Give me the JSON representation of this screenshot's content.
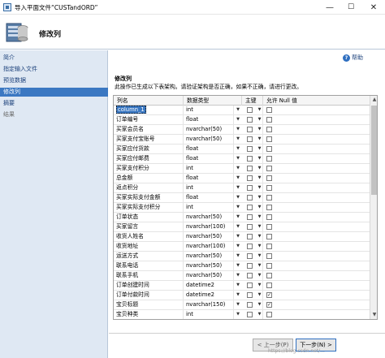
{
  "window": {
    "title": "导入平面文件“CUSTandORD”",
    "minimize": "—",
    "maximize": "☐",
    "close": "✕"
  },
  "header": {
    "title": "修改列"
  },
  "nav": {
    "items": [
      {
        "label": "简介",
        "state": "normal"
      },
      {
        "label": "指定输入文件",
        "state": "normal"
      },
      {
        "label": "预览数据",
        "state": "normal"
      },
      {
        "label": "修改列",
        "state": "active"
      },
      {
        "label": "摘要",
        "state": "normal"
      },
      {
        "label": "结果",
        "state": "disabled"
      }
    ]
  },
  "help": {
    "label": "帮助"
  },
  "section": {
    "title": "修改列",
    "description": "此操作已生成以下表架构。请验证架构是否正确，如果不正确，请进行更改。"
  },
  "grid": {
    "headers": {
      "name": "列名",
      "type": "数据类型",
      "key": "主键",
      "null": "允许 Null 值"
    },
    "rows": [
      {
        "name": "column_1",
        "type": "int",
        "key": false,
        "nullable": false,
        "selected": true
      },
      {
        "name": "订单编号",
        "type": "float",
        "key": false,
        "nullable": false
      },
      {
        "name": "买家会员名",
        "type": "nvarchar(50)",
        "key": false,
        "nullable": false
      },
      {
        "name": "买家支付宝账号",
        "type": "nvarchar(50)",
        "key": false,
        "nullable": false
      },
      {
        "name": "买家应付货款",
        "type": "float",
        "key": false,
        "nullable": false
      },
      {
        "name": "买家应付邮费",
        "type": "float",
        "key": false,
        "nullable": false
      },
      {
        "name": "买家支付积分",
        "type": "int",
        "key": false,
        "nullable": false
      },
      {
        "name": "总金额",
        "type": "float",
        "key": false,
        "nullable": false
      },
      {
        "name": "返点积分",
        "type": "int",
        "key": false,
        "nullable": false
      },
      {
        "name": "买家实际支付金额",
        "type": "float",
        "key": false,
        "nullable": false
      },
      {
        "name": "买家实际支付积分",
        "type": "int",
        "key": false,
        "nullable": false
      },
      {
        "name": "订单状态",
        "type": "nvarchar(50)",
        "key": false,
        "nullable": false
      },
      {
        "name": "买家留言",
        "type": "nvarchar(100)",
        "key": false,
        "nullable": false
      },
      {
        "name": "收货人姓名",
        "type": "nvarchar(50)",
        "key": false,
        "nullable": false
      },
      {
        "name": "收货地址",
        "type": "nvarchar(100)",
        "key": false,
        "nullable": false
      },
      {
        "name": "运送方式",
        "type": "nvarchar(50)",
        "key": false,
        "nullable": false
      },
      {
        "name": "联系电话",
        "type": "nvarchar(50)",
        "key": false,
        "nullable": false
      },
      {
        "name": "联系手机",
        "type": "nvarchar(50)",
        "key": false,
        "nullable": false
      },
      {
        "name": "订单创建时间",
        "type": "datetime2",
        "key": false,
        "nullable": false
      },
      {
        "name": "订单付款时间",
        "type": "datetime2",
        "key": false,
        "nullable": true
      },
      {
        "name": "宝贝标题",
        "type": "nvarchar(150)",
        "key": false,
        "nullable": true
      },
      {
        "name": "宝贝种类",
        "type": "int",
        "key": false,
        "nullable": false
      }
    ]
  },
  "footer": {
    "back": "< 上一步(P)",
    "next": "下一步(N) >",
    "watermark": "https://blog.csdn.net/..."
  }
}
